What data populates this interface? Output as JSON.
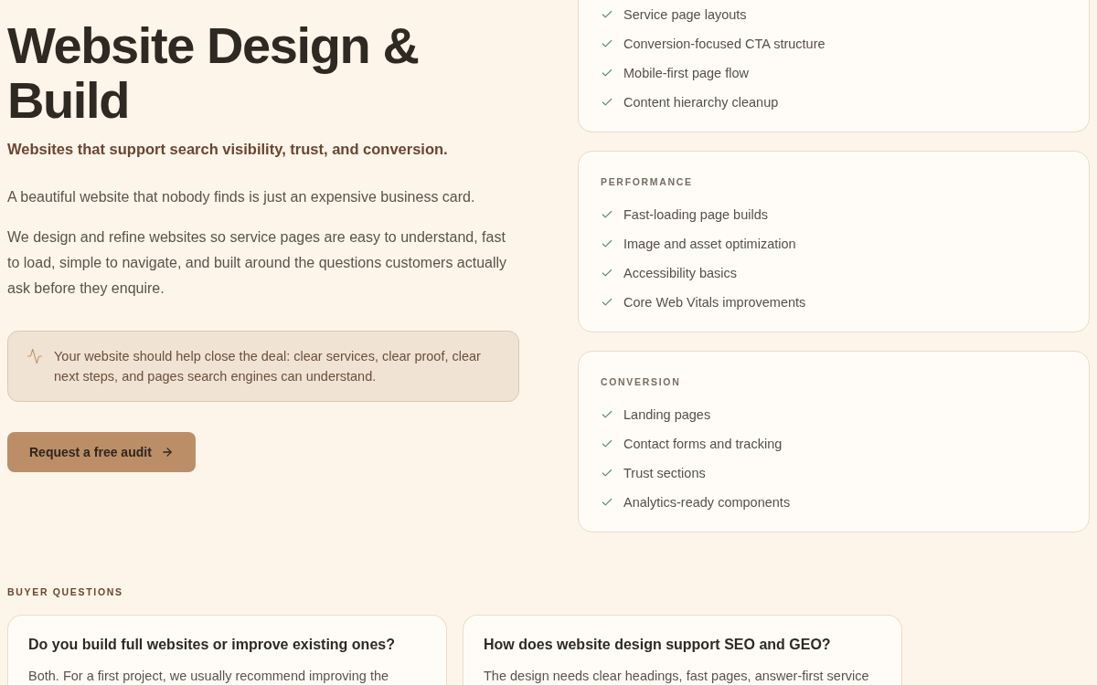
{
  "hero": {
    "title": "Website Design & Build",
    "subtitle": "Websites that support search visibility, trust, and conversion.",
    "paragraphs": [
      "A beautiful website that nobody finds is just an expensive business card.",
      "We design and refine websites so service pages are easy to understand, fast to load, simple to navigate, and built around the questions customers actually ask before they enquire."
    ],
    "callout": {
      "text": "Your website should help close the deal: clear services, clear proof, clear next steps, and pages search engines can understand."
    },
    "cta": {
      "label": "Request a free audit"
    }
  },
  "feature_groups": [
    {
      "items": [
        "Service page layouts",
        "Conversion-focused CTA structure",
        "Mobile-first page flow",
        "Content hierarchy cleanup"
      ]
    },
    {
      "title": "PERFORMANCE",
      "items": [
        "Fast-loading page builds",
        "Image and asset optimization",
        "Accessibility basics",
        "Core Web Vitals improvements"
      ]
    },
    {
      "title": "CONVERSION",
      "items": [
        "Landing pages",
        "Contact forms and tracking",
        "Trust sections",
        "Analytics-ready components"
      ]
    }
  ],
  "faq": {
    "title": "BUYER QUESTIONS",
    "items": [
      {
        "question": "Do you build full websites or improve existing ones?",
        "answer": "Both. For a first project, we usually recommend improving the"
      },
      {
        "question": "How does website design support SEO and GEO?",
        "answer": "The design needs clear headings, fast pages, answer-first service"
      }
    ]
  }
}
